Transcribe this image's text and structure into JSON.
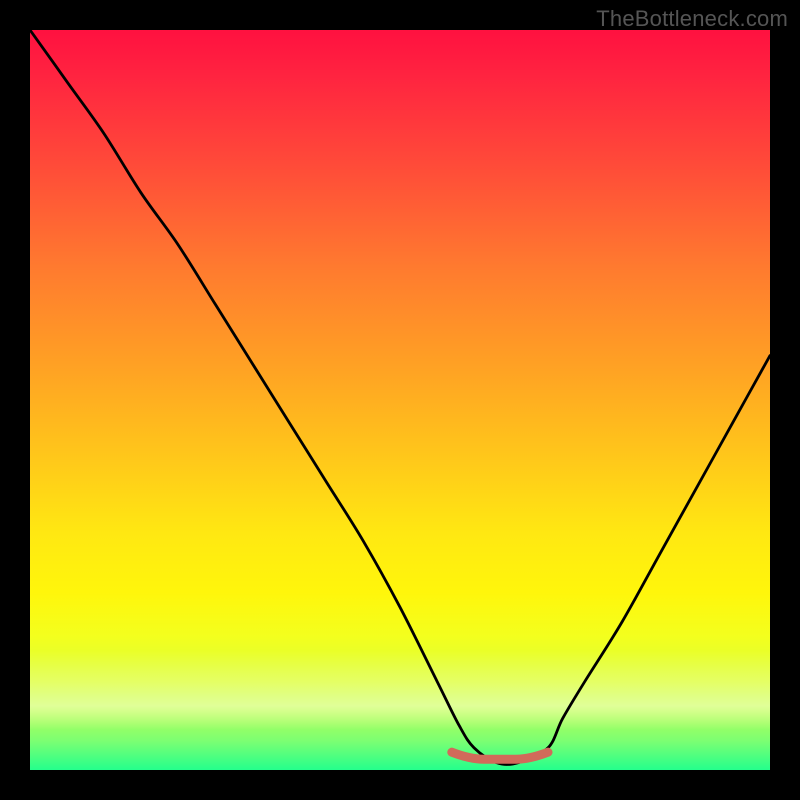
{
  "watermark": "TheBottleneck.com",
  "chart_data": {
    "type": "line",
    "title": "",
    "xlabel": "",
    "ylabel": "",
    "xlim": [
      0,
      100
    ],
    "ylim": [
      0,
      100
    ],
    "grid": false,
    "legend": false,
    "series": [
      {
        "name": "bottleneck-curve",
        "x": [
          0,
          5,
          10,
          15,
          20,
          25,
          30,
          35,
          40,
          45,
          50,
          55,
          58,
          60,
          63,
          66,
          70,
          72,
          75,
          80,
          85,
          90,
          95,
          100
        ],
        "y": [
          100,
          93,
          86,
          78,
          71,
          63,
          55,
          47,
          39,
          31,
          22,
          12,
          6,
          3,
          1,
          1,
          3,
          7,
          12,
          20,
          29,
          38,
          47,
          56
        ]
      }
    ],
    "annotations": [
      {
        "name": "optimal-segment",
        "type": "marker-line",
        "color": "#d16a5a",
        "x_start": 57,
        "x_end": 70,
        "y": 2
      }
    ],
    "background_gradient": {
      "type": "vertical",
      "stops": [
        {
          "pos": 0,
          "color": "#ff1140"
        },
        {
          "pos": 50,
          "color": "#ffb41e"
        },
        {
          "pos": 75,
          "color": "#fff60b"
        },
        {
          "pos": 100,
          "color": "#24ff8c"
        }
      ]
    }
  }
}
